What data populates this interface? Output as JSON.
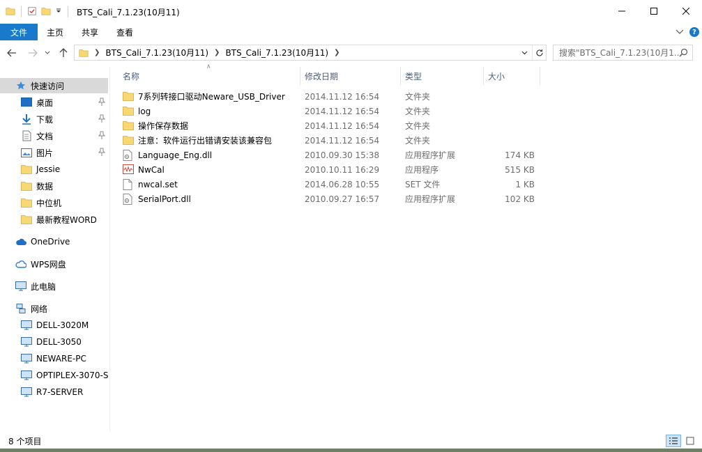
{
  "window": {
    "title": "BTS_Cali_7.1.23(10月11)"
  },
  "ribbon": {
    "tabs": [
      {
        "label": "文件"
      },
      {
        "label": "主页"
      },
      {
        "label": "共享"
      },
      {
        "label": "查看"
      }
    ]
  },
  "address": {
    "crumbs": [
      "BTS_Cali_7.1.23(10月11)",
      "BTS_Cali_7.1.23(10月11)"
    ],
    "search_placeholder": "搜索\"BTS_Cali_7.1.23(10月1..."
  },
  "sidebar": {
    "quick_access": "快速访问",
    "pinned": [
      {
        "label": "桌面",
        "icon": "desktop-icon"
      },
      {
        "label": "下载",
        "icon": "download-icon"
      },
      {
        "label": "文档",
        "icon": "document-icon"
      },
      {
        "label": "图片",
        "icon": "picture-icon"
      }
    ],
    "folders": [
      {
        "label": "Jessie"
      },
      {
        "label": "数据"
      },
      {
        "label": "中位机"
      },
      {
        "label": "最新教程WORD"
      }
    ],
    "onedrive": "OneDrive",
    "wps": "WPS网盘",
    "this_pc": "此电脑",
    "network": "网络",
    "computers": [
      {
        "label": "DELL-3020M"
      },
      {
        "label": "DELL-3050"
      },
      {
        "label": "NEWARE-PC"
      },
      {
        "label": "OPTIPLEX-3070-S"
      },
      {
        "label": "R7-SERVER"
      }
    ]
  },
  "columns": {
    "name": "名称",
    "date": "修改日期",
    "type": "类型",
    "size": "大小"
  },
  "files": [
    {
      "name": "7系列转接口驱动Neware_USB_Driver",
      "date": "2014.11.12 16:54",
      "type": "文件夹",
      "size": "",
      "icon": "folder-icon"
    },
    {
      "name": "log",
      "date": "2014.11.12 16:54",
      "type": "文件夹",
      "size": "",
      "icon": "folder-icon"
    },
    {
      "name": "操作保存数据",
      "date": "2014.11.12 16:54",
      "type": "文件夹",
      "size": "",
      "icon": "folder-icon"
    },
    {
      "name": "注意：软件运行出错请安装该兼容包",
      "date": "2014.11.12 16:54",
      "type": "文件夹",
      "size": "",
      "icon": "folder-icon"
    },
    {
      "name": "Language_Eng.dll",
      "date": "2010.09.30 15:38",
      "type": "应用程序扩展",
      "size": "174 KB",
      "icon": "dll-icon"
    },
    {
      "name": "NwCal",
      "date": "2010.10.11 16:29",
      "type": "应用程序",
      "size": "515 KB",
      "icon": "app-icon"
    },
    {
      "name": "nwcal.set",
      "date": "2014.06.28 10:55",
      "type": "SET 文件",
      "size": "1 KB",
      "icon": "file-icon"
    },
    {
      "name": "SerialPort.dll",
      "date": "2010.09.27 16:57",
      "type": "应用程序扩展",
      "size": "102 KB",
      "icon": "dll-icon"
    }
  ],
  "status": {
    "count": "8 个项目"
  },
  "colors": {
    "accent": "#1979ca",
    "folder": "#f8d775",
    "selected": "#d9d9d9"
  }
}
